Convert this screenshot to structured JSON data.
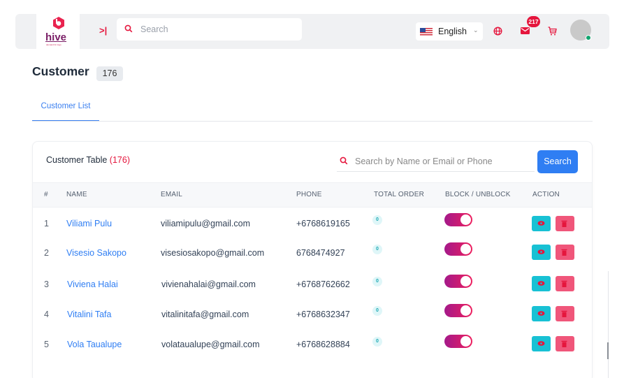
{
  "brand": {
    "logo_text": "hive",
    "tagline": "demand for logo"
  },
  "header": {
    "search_placeholder": "Search",
    "language": "English",
    "notification_count": "217"
  },
  "page": {
    "title": "Customer",
    "count": "176"
  },
  "tabs": [
    {
      "label": "Customer List"
    }
  ],
  "table": {
    "title": "Customer Table",
    "title_count": "(176)",
    "search_placeholder": "Search by Name or Email or Phone",
    "search_button": "Search",
    "columns": [
      "#",
      "NAME",
      "EMAIL",
      "PHONE",
      "TOTAL ORDER",
      "BLOCK / UNBLOCK",
      "ACTION"
    ],
    "rows": [
      {
        "idx": "1",
        "name": "Viliami Pulu",
        "email": "viliamipulu@gmail.com",
        "phone": "+6768619165",
        "orders": "0",
        "blocked": true
      },
      {
        "idx": "2",
        "name": "Visesio Sakopo",
        "email": "visesiosakopo@gmail.com",
        "phone": "6768474927",
        "orders": "0",
        "blocked": true
      },
      {
        "idx": "3",
        "name": "Viviena Halai",
        "email": "vivienahalai@gmail.com",
        "phone": "+6768762662",
        "orders": "0",
        "blocked": true
      },
      {
        "idx": "4",
        "name": "Vitalini Tafa",
        "email": "vitalinitafa@gmail.com",
        "phone": "+6768632347",
        "orders": "0",
        "blocked": true
      },
      {
        "idx": "5",
        "name": "Vola Taualupe",
        "email": "volataualupe@gmail.com",
        "phone": "+6768628884",
        "orders": "0",
        "blocked": true
      }
    ]
  },
  "colors": {
    "accent": "#2f7ef3",
    "danger": "#e5163d",
    "toggle_start": "#a4198a",
    "toggle_end": "#ee1f5e",
    "view": "#18c1d4",
    "delete": "#f0567a"
  },
  "icons": [
    "hive-logo-icon",
    "collapse-icon",
    "search-icon",
    "flag-us-icon",
    "chevron-down-icon",
    "globe-icon",
    "mail-icon",
    "cart-icon",
    "avatar",
    "eye-icon",
    "trash-icon"
  ]
}
